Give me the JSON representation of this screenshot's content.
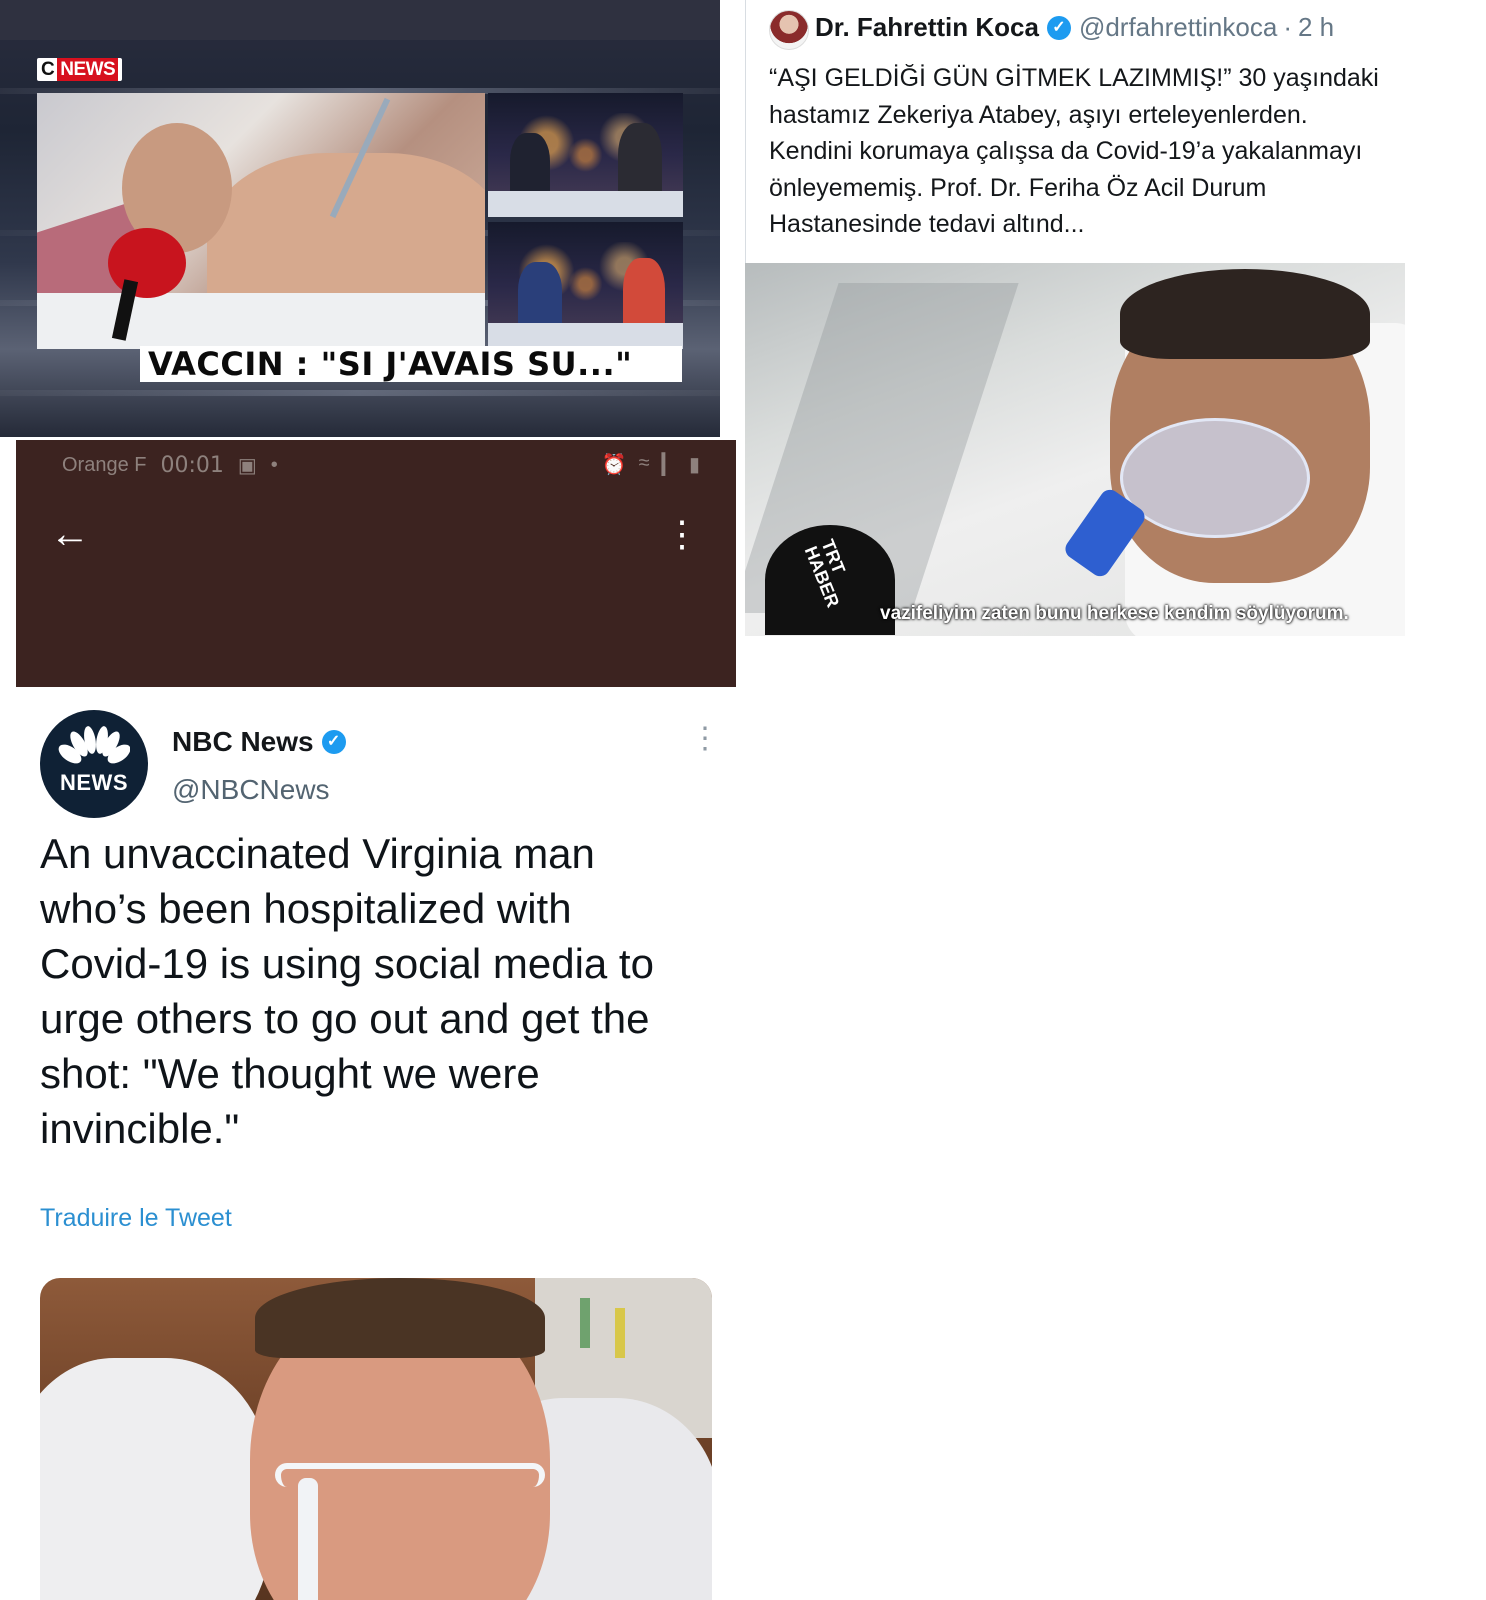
{
  "cnews_panel": {
    "logo": {
      "c": "C",
      "news": "NEWS"
    },
    "banner": "VACCIN : \"SI J'AVAIS SU...\""
  },
  "android_bar": {
    "carrier": "Orange F",
    "time": "00:01",
    "back_icon": "arrow-left-icon",
    "menu_icon": "more-vertical-icon"
  },
  "turkish_tweet": {
    "author_name": "Dr. Fahrettin Koca",
    "handle": "@drfahrettinkoca",
    "separator": "·",
    "age": "2 h",
    "text": "“AŞI GELDİĞİ GÜN GİTMEK LAZIMMIŞ!” 30 yaşındaki hastamız Zekeriya Atabey, aşıyı erteleyenlerden. Kendini korumaya çalışsa da Covid-19’a yakalanmayı önleyememiş. Prof. Dr. Feriha Öz Acil Durum Hastanesinde tedavi altınd...",
    "media": {
      "mic_label_1": "TRT",
      "mic_label_2": "HABER",
      "subtitle": "vazifeliyim zaten bunu herkese kendim söylüyorum."
    }
  },
  "nbc_tweet": {
    "avatar_word": "NEWS",
    "author_name": "NBC News",
    "handle": "@NBCNews",
    "text": "An unvaccinated Virginia man who’s been hospitalized with Covid-19 is using social media to urge others to go out and get the shot: \"We thought we were invincible.\"",
    "translate_link": "Traduire le Tweet"
  },
  "colors": {
    "verified_blue": "#1d9bf0",
    "cnews_red": "#d7101e",
    "link_blue": "#2b8fd1",
    "android_bg": "#3c2320",
    "nbc_navy": "#0f2135"
  }
}
